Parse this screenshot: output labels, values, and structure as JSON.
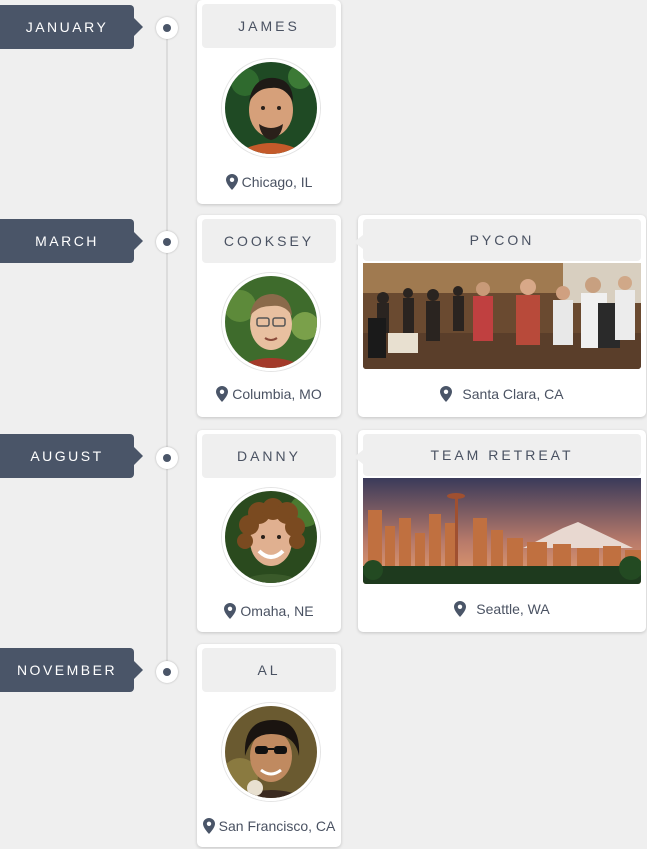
{
  "timeline": [
    {
      "month": "JANUARY",
      "person": {
        "name": "JAMES",
        "location": "Chicago, IL"
      }
    },
    {
      "month": "MARCH",
      "person": {
        "name": "COOKSEY",
        "location": "Columbia, MO"
      },
      "event": {
        "name": "PYCON",
        "location": "Santa Clara, CA"
      }
    },
    {
      "month": "AUGUST",
      "person": {
        "name": "DANNY",
        "location": "Omaha, NE"
      },
      "event": {
        "name": "TEAM RETREAT",
        "location": "Seattle, WA"
      }
    },
    {
      "month": "NOVEMBER",
      "person": {
        "name": "AL",
        "location": "San Francisco, CA"
      }
    }
  ],
  "icons": {
    "location": "map-pin-icon",
    "timeline_node": "timeline-dot-icon"
  },
  "colors": {
    "accent": "#4a5568",
    "background": "#efefef",
    "card": "#ffffff"
  }
}
